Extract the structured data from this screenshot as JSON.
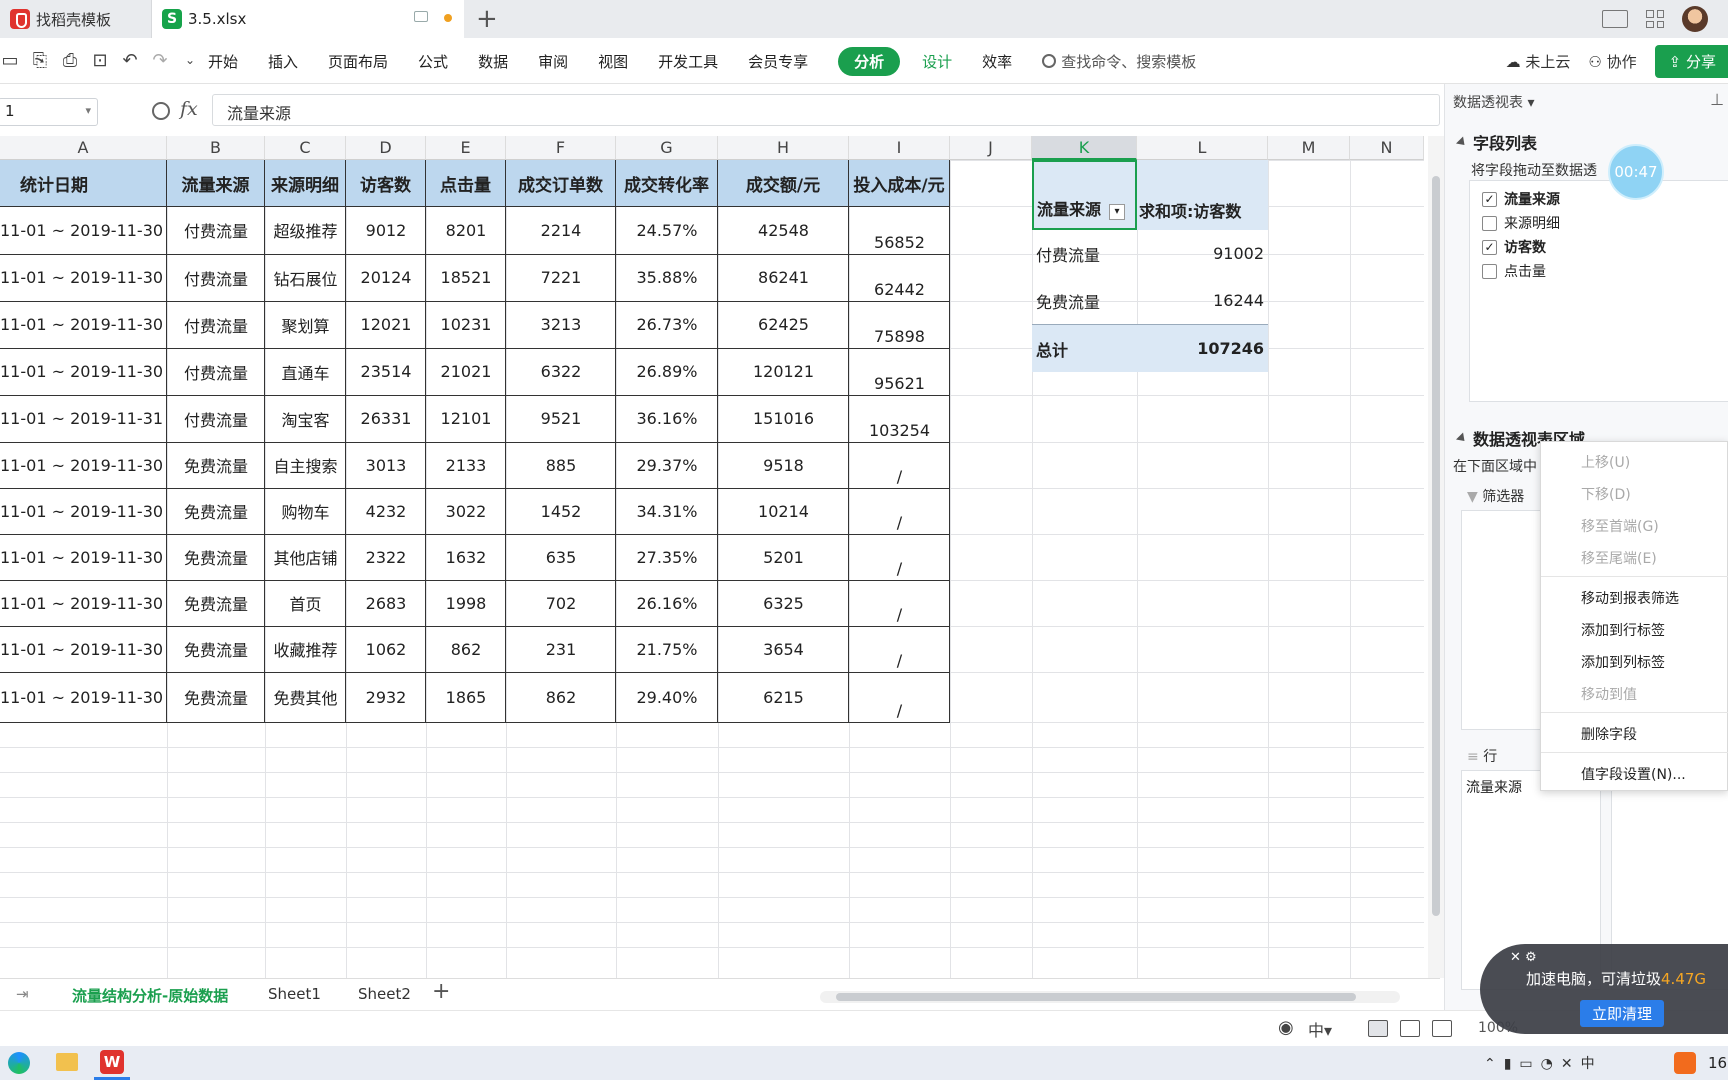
{
  "tabs": [
    {
      "label": "找稻壳模板"
    },
    {
      "label": "3.5.xlsx"
    }
  ],
  "toolbar": {
    "menu": [
      "开始",
      "插入",
      "页面布局",
      "公式",
      "数据",
      "审阅",
      "视图",
      "开发工具",
      "会员专享"
    ],
    "active_tab": "分析",
    "design_tab": "设计",
    "efficiency_tab": "效率",
    "search_placeholder": "查找命令、搜索模板",
    "cloud": "未上云",
    "collab": "协作",
    "share": "分享"
  },
  "formula_bar": {
    "name_box": "1",
    "fx": "fx",
    "value": "流量来源"
  },
  "columns": [
    "A",
    "B",
    "C",
    "D",
    "E",
    "F",
    "G",
    "H",
    "I",
    "J",
    "K",
    "L",
    "M",
    "N"
  ],
  "table": {
    "headers": [
      "统计日期",
      "流量来源",
      "来源明细",
      "访客数",
      "点击量",
      "成交订单数",
      "成交转化率",
      "成交额/元",
      "投入成本/元"
    ],
    "rows": [
      {
        "date": "11-01 ~ 2019-11-30",
        "source": "付费流量",
        "detail": "超级推荐",
        "visitors": "9012",
        "clicks": "8201",
        "orders": "2214",
        "rate": "24.57%",
        "amount": "42548",
        "cost": "56852"
      },
      {
        "date": "11-01 ~ 2019-11-30",
        "source": "付费流量",
        "detail": "钻石展位",
        "visitors": "20124",
        "clicks": "18521",
        "orders": "7221",
        "rate": "35.88%",
        "amount": "86241",
        "cost": "62442"
      },
      {
        "date": "11-01 ~ 2019-11-30",
        "source": "付费流量",
        "detail": "聚划算",
        "visitors": "12021",
        "clicks": "10231",
        "orders": "3213",
        "rate": "26.73%",
        "amount": "62425",
        "cost": "75898"
      },
      {
        "date": "11-01 ~ 2019-11-30",
        "source": "付费流量",
        "detail": "直通车",
        "visitors": "23514",
        "clicks": "21021",
        "orders": "6322",
        "rate": "26.89%",
        "amount": "120121",
        "cost": "95621"
      },
      {
        "date": "11-01 ~ 2019-11-31",
        "source": "付费流量",
        "detail": "淘宝客",
        "visitors": "26331",
        "clicks": "12101",
        "orders": "9521",
        "rate": "36.16%",
        "amount": "151016",
        "cost": "103254"
      },
      {
        "date": "11-01 ~ 2019-11-30",
        "source": "免费流量",
        "detail": "自主搜索",
        "visitors": "3013",
        "clicks": "2133",
        "orders": "885",
        "rate": "29.37%",
        "amount": "9518",
        "cost": "/"
      },
      {
        "date": "11-01 ~ 2019-11-30",
        "source": "免费流量",
        "detail": "购物车",
        "visitors": "4232",
        "clicks": "3022",
        "orders": "1452",
        "rate": "34.31%",
        "amount": "10214",
        "cost": "/"
      },
      {
        "date": "11-01 ~ 2019-11-30",
        "source": "免费流量",
        "detail": "其他店铺",
        "visitors": "2322",
        "clicks": "1632",
        "orders": "635",
        "rate": "27.35%",
        "amount": "5201",
        "cost": "/"
      },
      {
        "date": "11-01 ~ 2019-11-30",
        "source": "免费流量",
        "detail": "首页",
        "visitors": "2683",
        "clicks": "1998",
        "orders": "702",
        "rate": "26.16%",
        "amount": "6325",
        "cost": "/"
      },
      {
        "date": "11-01 ~ 2019-11-30",
        "source": "免费流量",
        "detail": "收藏推荐",
        "visitors": "1062",
        "clicks": "862",
        "orders": "231",
        "rate": "21.75%",
        "amount": "3654",
        "cost": "/"
      },
      {
        "date": "11-01 ~ 2019-11-30",
        "source": "免费流量",
        "detail": "免费其他",
        "visitors": "2932",
        "clicks": "1865",
        "orders": "862",
        "rate": "29.40%",
        "amount": "6215",
        "cost": "/"
      }
    ]
  },
  "pivot": {
    "row_header": "流量来源",
    "value_header": "求和项:访客数",
    "rows": [
      {
        "label": "付费流量",
        "value": "91002"
      },
      {
        "label": "免费流量",
        "value": "16244"
      }
    ],
    "total_label": "总计",
    "total_value": "107246"
  },
  "sheet_tabs": [
    "流量结构分析-原始数据",
    "Sheet1",
    "Sheet2"
  ],
  "status": {
    "zoom": "100%"
  },
  "panel": {
    "title": "数据透视表",
    "field_list_title": "字段列表",
    "field_list_hint": "将字段拖动至数据透",
    "fields": [
      {
        "label": "流量来源",
        "checked": true
      },
      {
        "label": "来源明细",
        "checked": false
      },
      {
        "label": "访客数",
        "checked": true
      },
      {
        "label": "点击量",
        "checked": false
      }
    ],
    "area_title": "数据透视表区域",
    "area_hint": "在下面区域中",
    "filter_label": "筛选器",
    "row_label": "行",
    "row_field": "流量来源",
    "timer": "00:47"
  },
  "context_menu": {
    "items": [
      {
        "label": "上移(U)",
        "disabled": true
      },
      {
        "label": "下移(D)",
        "disabled": true
      },
      {
        "label": "移至首端(G)",
        "disabled": true
      },
      {
        "label": "移至尾端(E)",
        "disabled": true
      },
      {
        "label": "移动到报表筛选",
        "disabled": false
      },
      {
        "label": "添加到行标签",
        "disabled": false
      },
      {
        "label": "添加到列标签",
        "disabled": false
      },
      {
        "label": "移动到值",
        "disabled": true
      },
      {
        "label": "删除字段",
        "disabled": false
      },
      {
        "label": "值字段设置(N)...",
        "disabled": false
      }
    ]
  },
  "toast": {
    "message": "加速电脑，可清垃圾",
    "size": "4.47G",
    "button": "立即清理"
  },
  "taskbar": {
    "clock": "16"
  },
  "colors": {
    "accent": "#1a9f4e",
    "header_fill": "#bdd7ee",
    "pivot_fill": "#dbe8f5"
  }
}
